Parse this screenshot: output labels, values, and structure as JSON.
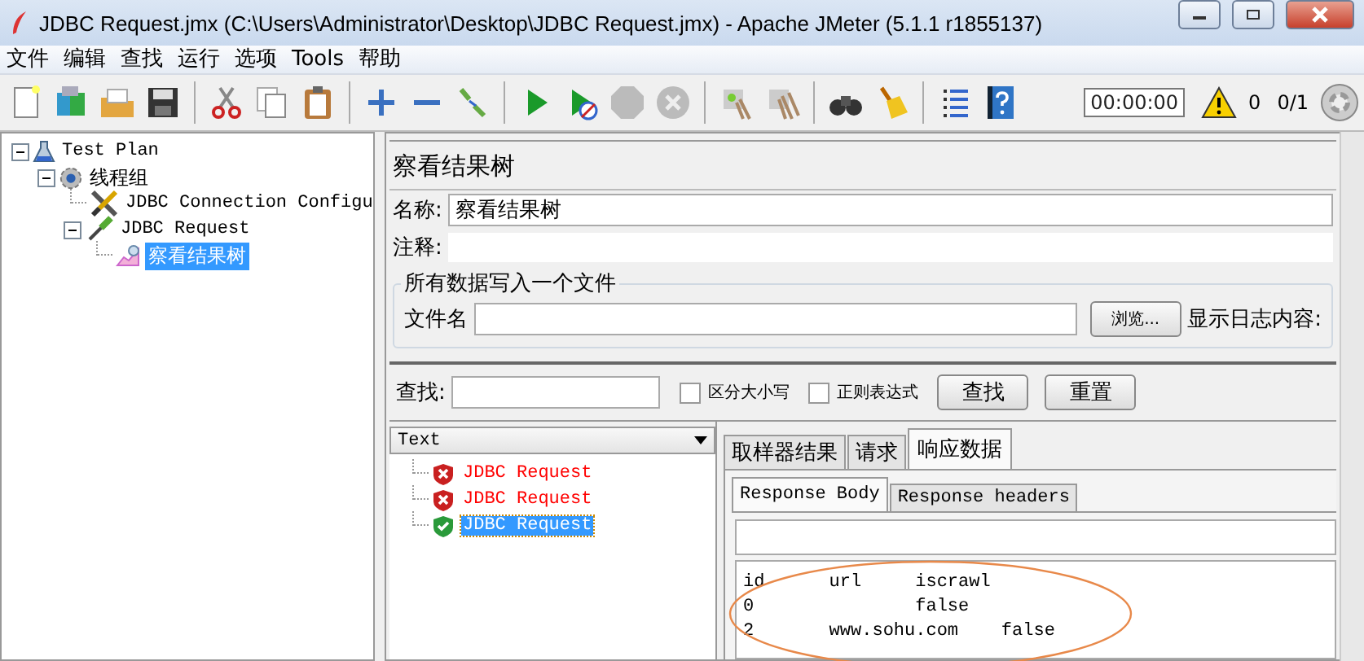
{
  "window": {
    "title": "JDBC Request.jmx (C:\\Users\\Administrator\\Desktop\\JDBC Request.jmx) - Apache JMeter (5.1.1 r1855137)"
  },
  "menu": [
    {
      "label": "文件"
    },
    {
      "label": "编辑"
    },
    {
      "label": "查找"
    },
    {
      "label": "运行"
    },
    {
      "label": "选项"
    },
    {
      "label": "Tools"
    },
    {
      "label": "帮助"
    }
  ],
  "status": {
    "timer": "00:00:00",
    "warnings": "0",
    "threads": "0/1"
  },
  "tree": [
    {
      "label": "Test Plan",
      "kind": "plan",
      "expanded": true,
      "selected": false,
      "children": [
        {
          "label": "线程组",
          "kind": "group",
          "expanded": true,
          "selected": false,
          "children": [
            {
              "label": "JDBC Connection Configu",
              "kind": "config",
              "selected": false
            },
            {
              "label": "JDBC Request",
              "kind": "sampler",
              "expanded": true,
              "selected": false,
              "children": [
                {
                  "label": "察看结果树",
                  "kind": "listener",
                  "selected": true
                }
              ]
            }
          ]
        }
      ]
    }
  ],
  "panel": {
    "title": "察看结果树",
    "name_label": "名称:",
    "name_value": "察看结果树",
    "comment_label": "注释:",
    "file_group": "所有数据写入一个文件",
    "file_label": "文件名",
    "browse": "浏览...",
    "log_label": "显示日志内容:",
    "search_label": "查找:",
    "case_option": {
      "label": "区分大小写",
      "checked": false
    },
    "regex_option": {
      "label": "正则表达式",
      "checked": false
    },
    "search_button": "查找",
    "reset_button": "重置"
  },
  "renderer": "Text",
  "results": [
    {
      "label": "JDBC Request",
      "passed": false,
      "selected": false
    },
    {
      "label": "JDBC Request",
      "passed": false,
      "selected": false
    },
    {
      "label": "JDBC Request",
      "passed": true,
      "selected": true
    }
  ],
  "tabs": [
    {
      "label": "取样器结果",
      "selected": false
    },
    {
      "label": "请求",
      "selected": false
    },
    {
      "label": "响应数据",
      "selected": true
    }
  ],
  "subtabs": [
    {
      "label": "Response Body",
      "selected": true
    },
    {
      "label": "Response headers",
      "selected": false
    }
  ],
  "response_lines": [
    "id      url     iscrawl",
    "0               false",
    "2       www.sohu.com    false"
  ]
}
